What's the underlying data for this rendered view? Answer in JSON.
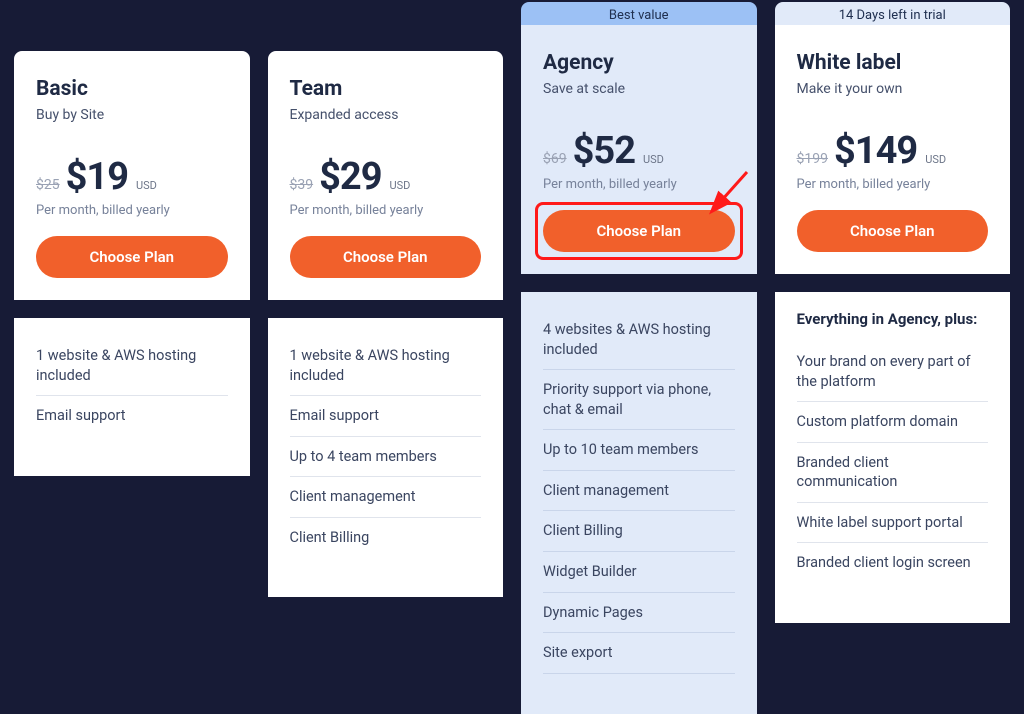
{
  "billing_note": "Per month, billed yearly",
  "currency": "USD",
  "cta_label": "Choose Plan",
  "badges": {
    "best": "Best value",
    "trial": "14 Days left in trial"
  },
  "plans": [
    {
      "name": "Basic",
      "subtitle": "Buy by Site",
      "old_price": "$25",
      "price": "$19",
      "features": [
        "1 website & AWS hosting included",
        "Email support"
      ]
    },
    {
      "name": "Team",
      "subtitle": "Expanded access",
      "old_price": "$39",
      "price": "$29",
      "features": [
        "1 website & AWS hosting included",
        "Email support",
        "Up to 4 team members",
        "Client management",
        "Client Billing"
      ]
    },
    {
      "name": "Agency",
      "subtitle": "Save at scale",
      "old_price": "$69",
      "price": "$52",
      "features": [
        "4 websites & AWS hosting included",
        "Priority support via phone, chat & email",
        "Up to 10 team members",
        "Client management",
        "Client Billing",
        "Widget Builder",
        "Dynamic Pages",
        "Site export"
      ]
    },
    {
      "name": "White label",
      "subtitle": "Make it your own",
      "old_price": "$199",
      "price": "$149",
      "features_heading": "Everything in Agency, plus:",
      "features": [
        "Your brand on every part of the platform",
        "Custom platform domain",
        "Branded client communication",
        "White label support portal",
        "Branded client login screen"
      ]
    }
  ],
  "annotation": {
    "target_plan": "Agency",
    "color": "#ff1a1a"
  }
}
